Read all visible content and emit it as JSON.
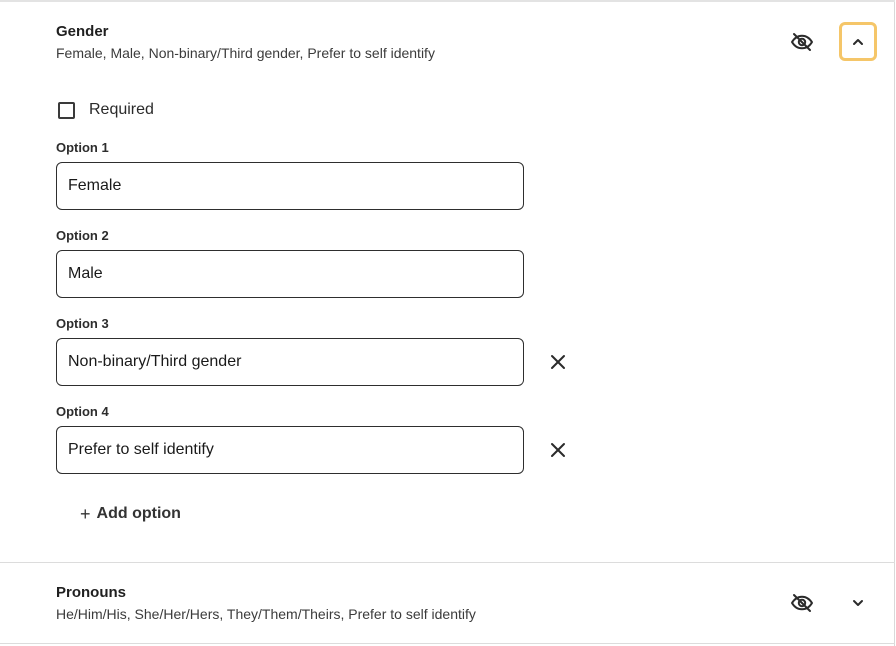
{
  "gender": {
    "title": "Gender",
    "summary": "Female, Male, Non-binary/Third gender, Prefer to self identify",
    "required_label": "Required",
    "options": [
      {
        "label": "Option 1",
        "value": "Female",
        "removable": false
      },
      {
        "label": "Option 2",
        "value": "Male",
        "removable": false
      },
      {
        "label": "Option 3",
        "value": "Non-binary/Third gender",
        "removable": true
      },
      {
        "label": "Option 4",
        "value": "Prefer to self identify",
        "removable": true
      }
    ],
    "add_option_label": "Add option",
    "add_option_icon": "+",
    "visibility_icon": "eye-slash-icon",
    "collapse_icon": "chevron-up-icon"
  },
  "pronouns": {
    "title": "Pronouns",
    "summary": "He/Him/His, She/Her/Hers, They/Them/Theirs, Prefer to self identify",
    "visibility_icon": "eye-slash-icon",
    "expand_icon": "chevron-down-icon"
  },
  "colors": {
    "focus_outline": "#f5c669",
    "border": "#2e2e2e",
    "divider": "#dcdcdc"
  }
}
